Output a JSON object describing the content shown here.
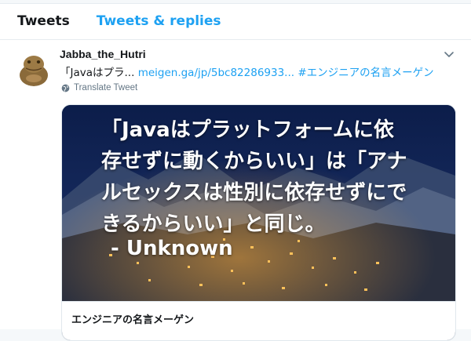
{
  "tabs": {
    "tweets": "Tweets",
    "replies": "Tweets & replies"
  },
  "tweet": {
    "handle": "Jabba_the_Hutri",
    "text_plain": "「Javaはプラ...",
    "text_link": "meigen.ga/jp/5bc82286933...",
    "hashtag": "#エンジニアの名言メーゲン",
    "translate": "Translate Tweet",
    "menu_icon": "chevron-down-icon",
    "avatar_icon": "jabba-avatar"
  },
  "card": {
    "quote": "「Javaはプラットフォームに依\n存せずに動くからいい」は「アナ\nルセックスは性別に依存せずにで\nきるからいい」と同じ。",
    "author": "- Unknown",
    "title": "エンジニアの名言メーゲン"
  },
  "colors": {
    "accent": "#1da1f2",
    "text": "#14171a",
    "muted": "#657786",
    "border": "#e6ecf0"
  }
}
